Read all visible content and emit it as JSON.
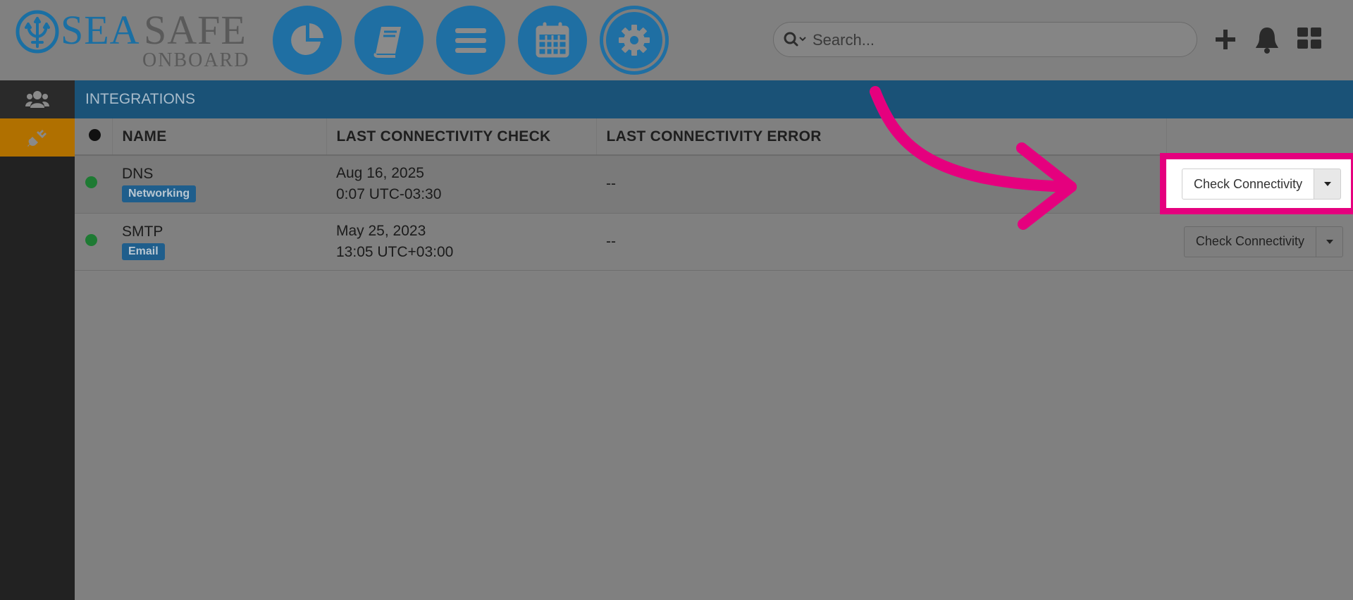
{
  "brand": {
    "sea": "SEA",
    "safe": "SAFE",
    "sub": "ONBOARD"
  },
  "nav": {
    "buttons": [
      {
        "name": "dashboard",
        "icon": "pie-chart-icon"
      },
      {
        "name": "logbook",
        "icon": "book-icon"
      },
      {
        "name": "menu",
        "icon": "list-icon"
      },
      {
        "name": "calendar",
        "icon": "calendar-icon"
      },
      {
        "name": "settings",
        "icon": "gear-icon",
        "active": true
      }
    ]
  },
  "search": {
    "placeholder": "Search..."
  },
  "toolbar": {
    "icons": [
      "plus-icon",
      "bell-icon",
      "apps-grid-icon"
    ]
  },
  "sidebar": {
    "items": [
      {
        "icon": "users-icon"
      },
      {
        "icon": "plug-icon",
        "active": true
      }
    ]
  },
  "section": {
    "title": "INTEGRATIONS"
  },
  "table": {
    "columns": [
      "NAME",
      "LAST CONNECTIVITY CHECK",
      "LAST CONNECTIVITY ERROR",
      ""
    ],
    "rows": [
      {
        "status": "ok",
        "name": "DNS",
        "tag": "Networking",
        "date": "Aug 16, 2025",
        "time": "0:07 UTC-03:30",
        "error": "--",
        "action": "Check Connectivity"
      },
      {
        "status": "ok",
        "name": "SMTP",
        "tag": "Email",
        "date": "May 25, 2023",
        "time": "13:05 UTC+03:00",
        "error": "--",
        "action": "Check Connectivity"
      }
    ]
  },
  "colors": {
    "brand_blue": "#1f6fa3",
    "header_blue": "#1a5277",
    "status_ok": "#1e7a33",
    "active_orange": "#b07000",
    "annotation_pink": "#e5007e"
  }
}
